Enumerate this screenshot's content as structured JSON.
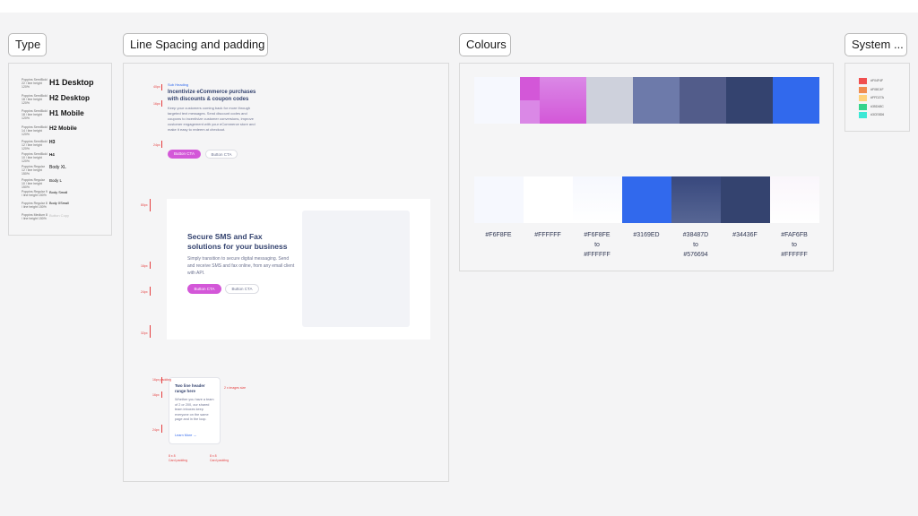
{
  "frames": {
    "type": "Type",
    "spacing": "Line Spacing and padding",
    "colours": "Colours",
    "system": "System ..."
  },
  "type_samples": [
    {
      "meta": "Poppins SemiBold 22 / line height 120%",
      "sample": "H1 Desktop"
    },
    {
      "meta": "Poppins SemiBold 18 / line height 120%",
      "sample": "H2 Desktop"
    },
    {
      "meta": "Poppins SemiBold 18 / line height 120%",
      "sample": "H1 Mobile"
    },
    {
      "meta": "Poppins SemiBold 14 / line height 120%",
      "sample": "H2 Mobile"
    },
    {
      "meta": "Poppins SemiBold 12 / line height 120%",
      "sample": "H3"
    },
    {
      "meta": "Poppins SemiBold 10 / line height 120%",
      "sample": "H4"
    },
    {
      "meta": "Poppins Regular 12 / line height 150%",
      "sample": "Body XL"
    },
    {
      "meta": "Poppins Regular 10 / line height 150%",
      "sample": "Body L"
    },
    {
      "meta": "Poppins Regular 9 / line height 150%",
      "sample": "Body Small"
    },
    {
      "meta": "Poppins Regular 8 / line height 150%",
      "sample": "Body XSmall"
    },
    {
      "meta": "Poppins Medium 8 / line height 150%",
      "sample": "Button Copy"
    }
  ],
  "spacing": {
    "block1": {
      "eyebrow": "Sub Heading",
      "heading": "Incentivize eCommerce purchases with discounts & coupon codes",
      "body": "Keep your customers coming back for more through targeted text messages. Send discount codes and coupons to incentivize customer conversions, improve customer engagement with your eCommerce store and make it easy to redeem at checkout.",
      "cta_primary": "Button CTA",
      "cta_secondary": "Button CTA"
    },
    "block2": {
      "heading": "Secure SMS and Fax solutions for your business",
      "body": "Simply transition to secure digital messaging. Send and receive SMS and fax online, from any email client with API.",
      "cta_primary": "Button CTA",
      "cta_secondary": "Button CTA"
    },
    "block3": {
      "heading": "Two line header range here",
      "body": "Whether you have a team of 2 or 200, our shared team inboxes keep everyone on the same page and in the loop.",
      "link": "Learn More",
      "note": "2 x images size"
    },
    "annotations": {
      "a40": "40px",
      "a16": "16px",
      "a24": "24px",
      "a80": "80px",
      "a32": "32px",
      "pad16": "16px padding",
      "side1": "8 x 8",
      "side2": "8 x 8",
      "sub1": "Card padding",
      "sub2": "Card padding"
    }
  },
  "colours": {
    "row1": [
      "#F6F8FE",
      "#D357D8",
      "#DA88E6",
      "#CED1DC",
      "#6D7AAA",
      "#525C8A",
      "#34436F",
      "#3169ED"
    ],
    "row2_labels": [
      {
        "lines": [
          "#F6F8FE"
        ]
      },
      {
        "lines": [
          "#FFFFFF"
        ]
      },
      {
        "lines": [
          "#F6F8FE",
          "to",
          "#FFFFFF"
        ]
      },
      {
        "lines": [
          "#3169ED"
        ]
      },
      {
        "lines": [
          "#38487D",
          "to",
          "#576694"
        ]
      },
      {
        "lines": [
          "#34436F"
        ]
      },
      {
        "lines": [
          "#FAF6FB",
          "to",
          "#FFFFFF"
        ]
      }
    ]
  },
  "system": [
    {
      "hex": "#F04F4F",
      "color": "#f04f4f"
    },
    {
      "hex": "#F08C4F",
      "color": "#f08c4f"
    },
    {
      "hex": "#FFD27A",
      "color": "#ffd27a"
    },
    {
      "hex": "#35D48C",
      "color": "#35d48c"
    },
    {
      "hex": "#3CE8D6",
      "color": "#3ce8d6"
    }
  ]
}
